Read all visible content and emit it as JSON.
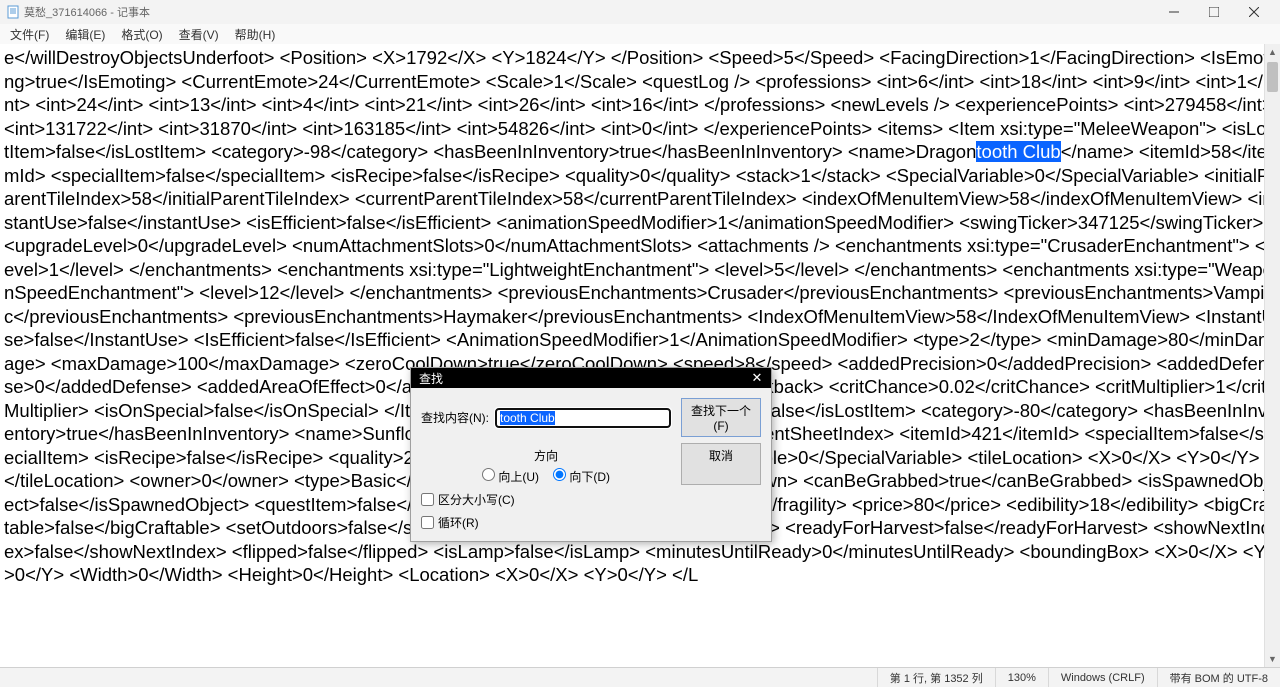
{
  "window": {
    "title": "莫愁_371614066 - 记事本"
  },
  "menu": {
    "file": "文件(F)",
    "edit": "编辑(E)",
    "format": "格式(O)",
    "view": "查看(V)",
    "help": "帮助(H)"
  },
  "content": {
    "pre_highlight": "e</willDestroyObjectsUnderfoot> <Position> <X>1792</X> <Y>1824</Y> </Position> <Speed>5</Speed> <FacingDirection>1</FacingDirection> <IsEmoting>true</IsEmoting> <CurrentEmote>24</CurrentEmote> <Scale>1</Scale> <questLog /> <professions> <int>6</int> <int>18</int> <int>9</int> <int>1</int> <int>24</int> <int>13</int> <int>4</int> <int>21</int> <int>26</int> <int>16</int> </professions> <newLevels /> <experiencePoints> <int>279458</int> <int>131722</int> <int>31870</int> <int>163185</int> <int>54826</int> <int>0</int> </experiencePoints> <items> <Item xsi:type=\"MeleeWeapon\"> <isLostItem>false</isLostItem> <category>-98</category> <hasBeenInInventory>true</hasBeenInInventory> <name>Dragon",
    "highlight": "tooth Club",
    "post_highlight": "</name> <itemId>58</itemId> <specialItem>false</specialItem> <isRecipe>false</isRecipe> <quality>0</quality> <stack>1</stack> <SpecialVariable>0</SpecialVariable> <initialParentTileIndex>58</initialParentTileIndex> <currentParentTileIndex>58</currentParentTileIndex> <indexOfMenuItemView>58</indexOfMenuItemView> <instantUse>false</instantUse> <isEfficient>false</isEfficient> <animationSpeedModifier>1</animationSpeedModifier> <swingTicker>347125</swingTicker> <upgradeLevel>0</upgradeLevel> <numAttachmentSlots>0</numAttachmentSlots> <attachments /> <enchantments xsi:type=\"CrusaderEnchantment\"> <level>1</level> </enchantments> <enchantments xsi:type=\"LightweightEnchantment\"> <level>5</level> </enchantments> <enchantments xsi:type=\"WeaponSpeedEnchantment\"> <level>12</level> </enchantments> <previousEnchantments>Crusader</previousEnchantments> <previousEnchantments>Vampiric</previousEnchantments> <previousEnchantments>Haymaker</previousEnchantments> <IndexOfMenuItemView>58</IndexOfMenuItemView> <InstantUse>false</InstantUse> <IsEfficient>false</IsEfficient> <AnimationSpeedModifier>1</AnimationSpeedModifier> <type>2</type> <minDamage>80</minDamage> <maxDamage>100</maxDamage> <zeroCoolDown>true</zeroCoolDown> <speed>8</speed> <addedPrecision>0</addedPrecision> <addedDefense>0</addedDefense> <addedAreaOfEffect>0</addedAreaOfEffect> <knockback>1.3</knockback> <critChance>0.02</critChance> <critMultiplier>1</critMultiplier> <isOnSpecial>false</isOnSpecial> </Item> <Item xsi:type=\"Object\"> <isLostItem>false</isLostItem> <category>-80</category> <hasBeenInInventory>true</hasBeenInInventory> <name>Sunflower</name> <parentSheetIndex>421</parentSheetIndex> <itemId>421</itemId> <specialItem>false</specialItem> <isRecipe>false</isRecipe> <quality>2</quality> <stack>1</stack> <SpecialVariable>0</SpecialVariable> <tileLocation> <X>0</X> <Y>0</Y> </tileLocation> <owner>0</owner> <type>Basic</type> <canBeSetDown>true</canBeSetDown> <canBeGrabbed>true</canBeGrabbed> <isSpawnedObject>false</isSpawnedObject> <questItem>false</questItem> <isOn>true</isOn> <fragility>0</fragility> <price>80</price> <edibility>18</edibility> <bigCraftable>false</bigCraftable> <setOutdoors>false</setOutdoors> <setIndoors>false</setIndoors> <readyForHarvest>false</readyForHarvest> <showNextIndex>false</showNextIndex> <flipped>false</flipped> <isLamp>false</isLamp> <minutesUntilReady>0</minutesUntilReady> <boundingBox> <X>0</X> <Y>0</Y> <Width>0</Width> <Height>0</Height> <Location> <X>0</X> <Y>0</Y> </L"
  },
  "find": {
    "title": "查找",
    "label_what": "查找内容(N):",
    "value": "tooth Club",
    "btn_next": "查找下一个(F)",
    "btn_cancel": "取消",
    "direction_label": "方向",
    "dir_up": "向上(U)",
    "dir_down": "向下(D)",
    "match_case": "区分大小写(C)",
    "wrap": "循环(R)"
  },
  "status": {
    "position": "第 1 行, 第 1352 列",
    "zoom": "130%",
    "eol": "Windows (CRLF)",
    "encoding": "带有 BOM 的 UTF-8"
  }
}
